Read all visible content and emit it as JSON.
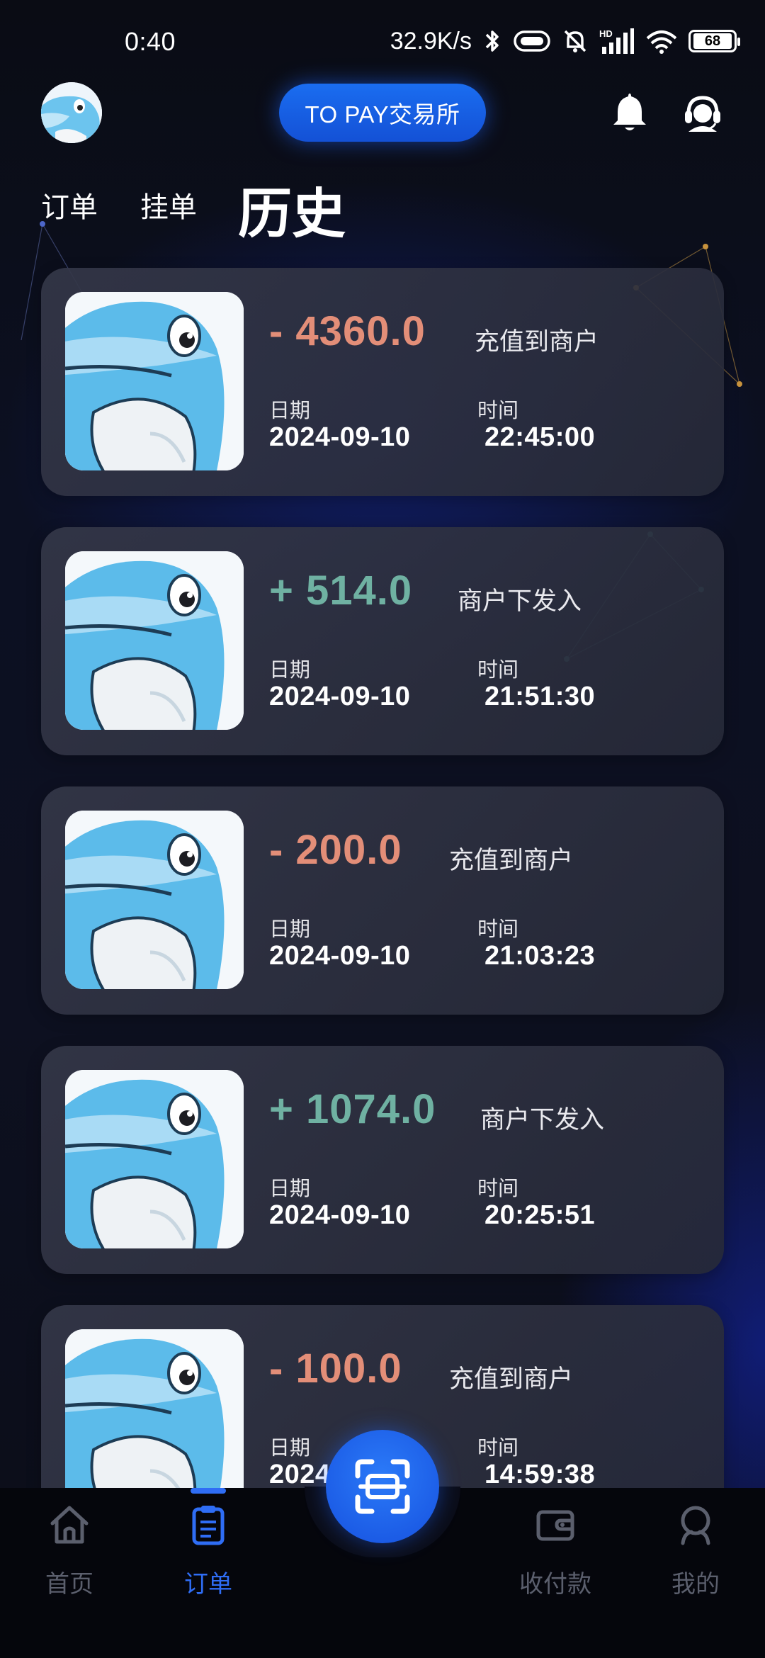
{
  "status_bar": {
    "time": "0:40",
    "network_speed": "32.9K/s",
    "battery": "68"
  },
  "header": {
    "exchange_label": "TO PAY交易所"
  },
  "tabs": [
    {
      "label": "订单"
    },
    {
      "label": "挂单"
    },
    {
      "label": "历史"
    }
  ],
  "labels": {
    "date": "日期",
    "time": "时间"
  },
  "transactions": [
    {
      "amount": "- 4360.0",
      "type": "negative",
      "description": "充值到商户",
      "date": "2024-09-10",
      "time": "22:45:00"
    },
    {
      "amount": "+ 514.0",
      "type": "positive",
      "description": "商户下发入",
      "date": "2024-09-10",
      "time": "21:51:30"
    },
    {
      "amount": "- 200.0",
      "type": "negative",
      "description": "充值到商户",
      "date": "2024-09-10",
      "time": "21:03:23"
    },
    {
      "amount": "+ 1074.0",
      "type": "positive",
      "description": "商户下发入",
      "date": "2024-09-10",
      "time": "20:25:51"
    },
    {
      "amount": "- 100.0",
      "type": "negative",
      "description": "充值到商户",
      "date": "2024",
      "time": "14:59:38"
    }
  ],
  "bottom_nav": [
    {
      "label": "首页",
      "icon": "home-icon",
      "active": false
    },
    {
      "label": "订单",
      "icon": "orders-icon",
      "active": true
    },
    {
      "label": "收付款",
      "icon": "wallet-icon",
      "active": false
    },
    {
      "label": "我的",
      "icon": "profile-icon",
      "active": false
    }
  ],
  "colors": {
    "accent_blue": "#1a6df0",
    "negative": "#e38e78",
    "positive": "#6fb1a2",
    "nav_active": "#2f6df5"
  }
}
